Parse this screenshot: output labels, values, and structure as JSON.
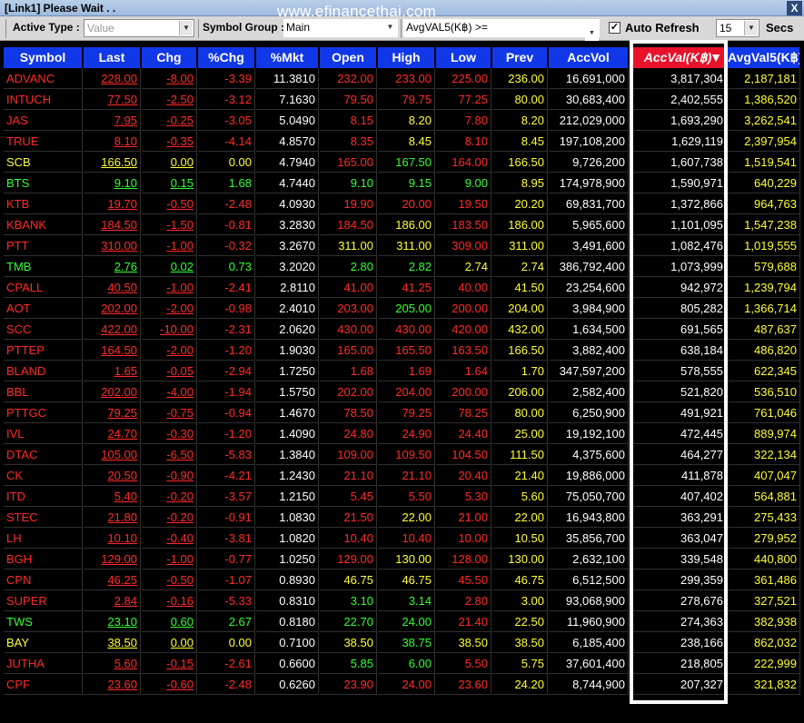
{
  "window": {
    "title": "[Link1] Please Wait . .",
    "close_label": "X"
  },
  "watermark": "www.efinancethai.com",
  "toolbar": {
    "active_type_label": "Active Type :",
    "active_type_value": "Value",
    "symbol_group_label": "Symbol Group :",
    "symbol_group_value": "Main",
    "avg_filter_label": "AvgVAL5(K฿) >=",
    "auto_refresh_label": "Auto Refresh",
    "auto_refresh_checked": "✓",
    "refresh_interval": "15",
    "secs_label": "Secs"
  },
  "columns": [
    "Symbol",
    "Last",
    "Chg",
    "%Chg",
    "%Mkt",
    "Open",
    "High",
    "Low",
    "Prev",
    "AccVol",
    "AccVal(K฿)",
    "AvgVal5(K฿)"
  ],
  "sorted_indicator": "▼",
  "rows": [
    {
      "symbol": "ADVANC",
      "last": "228.00",
      "chg": "-8.00",
      "pchg": "-3.39",
      "mkt": "11.3810",
      "open": "232.00",
      "high": "233.00",
      "low": "225.00",
      "prev": "236.00",
      "accvol": "16,691,000",
      "accval": "3,817,304",
      "avgval": "2,187,181",
      "c": "red",
      "co": "red",
      "ch": "red",
      "cl": "red"
    },
    {
      "symbol": "INTUCH",
      "last": "77.50",
      "chg": "-2.50",
      "pchg": "-3.12",
      "mkt": "7.1630",
      "open": "79.50",
      "high": "79.75",
      "low": "77.25",
      "prev": "80.00",
      "accvol": "30,683,400",
      "accval": "2,402,555",
      "avgval": "1,386,520",
      "c": "red",
      "co": "red",
      "ch": "red",
      "cl": "red"
    },
    {
      "symbol": "JAS",
      "last": "7.95",
      "chg": "-0.25",
      "pchg": "-3.05",
      "mkt": "5.0490",
      "open": "8.15",
      "high": "8.20",
      "low": "7.80",
      "prev": "8.20",
      "accvol": "212,029,000",
      "accval": "1,693,290",
      "avgval": "3,262,541",
      "c": "red",
      "co": "red",
      "ch": "yellow",
      "cl": "red"
    },
    {
      "symbol": "TRUE",
      "last": "8.10",
      "chg": "-0.35",
      "pchg": "-4.14",
      "mkt": "4.8570",
      "open": "8.35",
      "high": "8.45",
      "low": "8.10",
      "prev": "8.45",
      "accvol": "197,108,200",
      "accval": "1,629,119",
      "avgval": "2,397,954",
      "c": "red",
      "co": "red",
      "ch": "yellow",
      "cl": "red"
    },
    {
      "symbol": "SCB",
      "last": "166.50",
      "chg": "0.00",
      "pchg": "0.00",
      "mkt": "4.7940",
      "open": "165.00",
      "high": "167.50",
      "low": "164.00",
      "prev": "166.50",
      "accvol": "9,726,200",
      "accval": "1,607,738",
      "avgval": "1,519,541",
      "c": "yellow",
      "co": "red",
      "ch": "green",
      "cl": "red"
    },
    {
      "symbol": "BTS",
      "last": "9.10",
      "chg": "0.15",
      "pchg": "1.68",
      "mkt": "4.7440",
      "open": "9.10",
      "high": "9.15",
      "low": "9.00",
      "prev": "8.95",
      "accvol": "174,978,900",
      "accval": "1,590,971",
      "avgval": "640,229",
      "c": "green",
      "co": "green",
      "ch": "green",
      "cl": "green"
    },
    {
      "symbol": "KTB",
      "last": "19.70",
      "chg": "-0.50",
      "pchg": "-2.48",
      "mkt": "4.0930",
      "open": "19.90",
      "high": "20.00",
      "low": "19.50",
      "prev": "20.20",
      "accvol": "69,831,700",
      "accval": "1,372,866",
      "avgval": "964,763",
      "c": "red",
      "co": "red",
      "ch": "red",
      "cl": "red"
    },
    {
      "symbol": "KBANK",
      "last": "184.50",
      "chg": "-1.50",
      "pchg": "-0.81",
      "mkt": "3.2830",
      "open": "184.50",
      "high": "186.00",
      "low": "183.50",
      "prev": "186.00",
      "accvol": "5,965,600",
      "accval": "1,101,095",
      "avgval": "1,547,238",
      "c": "red",
      "co": "red",
      "ch": "yellow",
      "cl": "red"
    },
    {
      "symbol": "PTT",
      "last": "310.00",
      "chg": "-1.00",
      "pchg": "-0.32",
      "mkt": "3.2670",
      "open": "311.00",
      "high": "311.00",
      "low": "309.00",
      "prev": "311.00",
      "accvol": "3,491,600",
      "accval": "1,082,476",
      "avgval": "1,019,555",
      "c": "red",
      "co": "yellow",
      "ch": "yellow",
      "cl": "red"
    },
    {
      "symbol": "TMB",
      "last": "2.76",
      "chg": "0.02",
      "pchg": "0.73",
      "mkt": "3.2020",
      "open": "2.80",
      "high": "2.82",
      "low": "2.74",
      "prev": "2.74",
      "accvol": "386,792,400",
      "accval": "1,073,999",
      "avgval": "579,688",
      "c": "green",
      "co": "green",
      "ch": "green",
      "cl": "yellow"
    },
    {
      "symbol": "CPALL",
      "last": "40.50",
      "chg": "-1.00",
      "pchg": "-2.41",
      "mkt": "2.8110",
      "open": "41.00",
      "high": "41.25",
      "low": "40.00",
      "prev": "41.50",
      "accvol": "23,254,600",
      "accval": "942,972",
      "avgval": "1,239,794",
      "c": "red",
      "co": "red",
      "ch": "red",
      "cl": "red"
    },
    {
      "symbol": "AOT",
      "last": "202.00",
      "chg": "-2.00",
      "pchg": "-0.98",
      "mkt": "2.4010",
      "open": "203.00",
      "high": "205.00",
      "low": "200.00",
      "prev": "204.00",
      "accvol": "3,984,900",
      "accval": "805,282",
      "avgval": "1,366,714",
      "c": "red",
      "co": "red",
      "ch": "green",
      "cl": "red"
    },
    {
      "symbol": "SCC",
      "last": "422.00",
      "chg": "-10.00",
      "pchg": "-2.31",
      "mkt": "2.0620",
      "open": "430.00",
      "high": "430.00",
      "low": "420.00",
      "prev": "432.00",
      "accvol": "1,634,500",
      "accval": "691,565",
      "avgval": "487,637",
      "c": "red",
      "co": "red",
      "ch": "red",
      "cl": "red"
    },
    {
      "symbol": "PTTEP",
      "last": "164.50",
      "chg": "-2.00",
      "pchg": "-1.20",
      "mkt": "1.9030",
      "open": "165.00",
      "high": "165.50",
      "low": "163.50",
      "prev": "166.50",
      "accvol": "3,882,400",
      "accval": "638,184",
      "avgval": "486,820",
      "c": "red",
      "co": "red",
      "ch": "red",
      "cl": "red"
    },
    {
      "symbol": "BLAND",
      "last": "1.65",
      "chg": "-0.05",
      "pchg": "-2.94",
      "mkt": "1.7250",
      "open": "1.68",
      "high": "1.69",
      "low": "1.64",
      "prev": "1.70",
      "accvol": "347,597,200",
      "accval": "578,555",
      "avgval": "622,345",
      "c": "red",
      "co": "red",
      "ch": "red",
      "cl": "red"
    },
    {
      "symbol": "BBL",
      "last": "202.00",
      "chg": "-4.00",
      "pchg": "-1.94",
      "mkt": "1.5750",
      "open": "202.00",
      "high": "204.00",
      "low": "200.00",
      "prev": "206.00",
      "accvol": "2,582,400",
      "accval": "521,820",
      "avgval": "536,510",
      "c": "red",
      "co": "red",
      "ch": "red",
      "cl": "red"
    },
    {
      "symbol": "PTTGC",
      "last": "79.25",
      "chg": "-0.75",
      "pchg": "-0.94",
      "mkt": "1.4670",
      "open": "78.50",
      "high": "79.25",
      "low": "78.25",
      "prev": "80.00",
      "accvol": "6,250,900",
      "accval": "491,921",
      "avgval": "761,046",
      "c": "red",
      "co": "red",
      "ch": "red",
      "cl": "red"
    },
    {
      "symbol": "IVL",
      "last": "24.70",
      "chg": "-0.30",
      "pchg": "-1.20",
      "mkt": "1.4090",
      "open": "24.80",
      "high": "24.90",
      "low": "24.40",
      "prev": "25.00",
      "accvol": "19,192,100",
      "accval": "472,445",
      "avgval": "889,974",
      "c": "red",
      "co": "red",
      "ch": "red",
      "cl": "red"
    },
    {
      "symbol": "DTAC",
      "last": "105.00",
      "chg": "-6.50",
      "pchg": "-5.83",
      "mkt": "1.3840",
      "open": "109.00",
      "high": "109.50",
      "low": "104.50",
      "prev": "111.50",
      "accvol": "4,375,600",
      "accval": "464,277",
      "avgval": "322,134",
      "c": "red",
      "co": "red",
      "ch": "red",
      "cl": "red"
    },
    {
      "symbol": "CK",
      "last": "20.50",
      "chg": "-0.90",
      "pchg": "-4.21",
      "mkt": "1.2430",
      "open": "21.10",
      "high": "21.10",
      "low": "20.40",
      "prev": "21.40",
      "accvol": "19,886,000",
      "accval": "411,878",
      "avgval": "407,047",
      "c": "red",
      "co": "red",
      "ch": "red",
      "cl": "red"
    },
    {
      "symbol": "ITD",
      "last": "5.40",
      "chg": "-0.20",
      "pchg": "-3.57",
      "mkt": "1.2150",
      "open": "5.45",
      "high": "5.50",
      "low": "5.30",
      "prev": "5.60",
      "accvol": "75,050,700",
      "accval": "407,402",
      "avgval": "564,881",
      "c": "red",
      "co": "red",
      "ch": "red",
      "cl": "red"
    },
    {
      "symbol": "STEC",
      "last": "21.80",
      "chg": "-0.20",
      "pchg": "-0.91",
      "mkt": "1.0830",
      "open": "21.50",
      "high": "22.00",
      "low": "21.00",
      "prev": "22.00",
      "accvol": "16,943,800",
      "accval": "363,291",
      "avgval": "275,433",
      "c": "red",
      "co": "red",
      "ch": "yellow",
      "cl": "red"
    },
    {
      "symbol": "LH",
      "last": "10.10",
      "chg": "-0.40",
      "pchg": "-3.81",
      "mkt": "1.0820",
      "open": "10.40",
      "high": "10.40",
      "low": "10.00",
      "prev": "10.50",
      "accvol": "35,856,700",
      "accval": "363,047",
      "avgval": "279,952",
      "c": "red",
      "co": "red",
      "ch": "red",
      "cl": "red"
    },
    {
      "symbol": "BGH",
      "last": "129.00",
      "chg": "-1.00",
      "pchg": "-0.77",
      "mkt": "1.0250",
      "open": "129.00",
      "high": "130.00",
      "low": "128.00",
      "prev": "130.00",
      "accvol": "2,632,100",
      "accval": "339,548",
      "avgval": "440,800",
      "c": "red",
      "co": "red",
      "ch": "yellow",
      "cl": "red"
    },
    {
      "symbol": "CPN",
      "last": "46.25",
      "chg": "-0.50",
      "pchg": "-1.07",
      "mkt": "0.8930",
      "open": "46.75",
      "high": "46.75",
      "low": "45.50",
      "prev": "46.75",
      "accvol": "6,512,500",
      "accval": "299,359",
      "avgval": "361,486",
      "c": "red",
      "co": "yellow",
      "ch": "yellow",
      "cl": "red"
    },
    {
      "symbol": "SUPER",
      "last": "2.84",
      "chg": "-0.16",
      "pchg": "-5.33",
      "mkt": "0.8310",
      "open": "3.10",
      "high": "3.14",
      "low": "2.80",
      "prev": "3.00",
      "accvol": "93,068,900",
      "accval": "278,676",
      "avgval": "327,521",
      "c": "red",
      "co": "green",
      "ch": "green",
      "cl": "red"
    },
    {
      "symbol": "TWS",
      "last": "23.10",
      "chg": "0.60",
      "pchg": "2.67",
      "mkt": "0.8180",
      "open": "22.70",
      "high": "24.00",
      "low": "21.40",
      "prev": "22.50",
      "accvol": "11,960,900",
      "accval": "274,363",
      "avgval": "382,938",
      "c": "green",
      "co": "green",
      "ch": "green",
      "cl": "red"
    },
    {
      "symbol": "BAY",
      "last": "38.50",
      "chg": "0.00",
      "pchg": "0.00",
      "mkt": "0.7100",
      "open": "38.50",
      "high": "38.75",
      "low": "38.50",
      "prev": "38.50",
      "accvol": "6,185,400",
      "accval": "238,166",
      "avgval": "862,032",
      "c": "yellow",
      "co": "yellow",
      "ch": "green",
      "cl": "yellow"
    },
    {
      "symbol": "JUTHA",
      "last": "5.60",
      "chg": "-0.15",
      "pchg": "-2.61",
      "mkt": "0.6600",
      "open": "5.85",
      "high": "6.00",
      "low": "5.50",
      "prev": "5.75",
      "accvol": "37,601,400",
      "accval": "218,805",
      "avgval": "222,999",
      "c": "red",
      "co": "green",
      "ch": "green",
      "cl": "red"
    },
    {
      "symbol": "CPF",
      "last": "23.60",
      "chg": "-0.60",
      "pchg": "-2.48",
      "mkt": "0.6260",
      "open": "23.90",
      "high": "24.00",
      "low": "23.60",
      "prev": "24.20",
      "accvol": "8,744,900",
      "accval": "207,327",
      "avgval": "321,832",
      "c": "red",
      "co": "red",
      "ch": "red",
      "cl": "red"
    }
  ]
}
